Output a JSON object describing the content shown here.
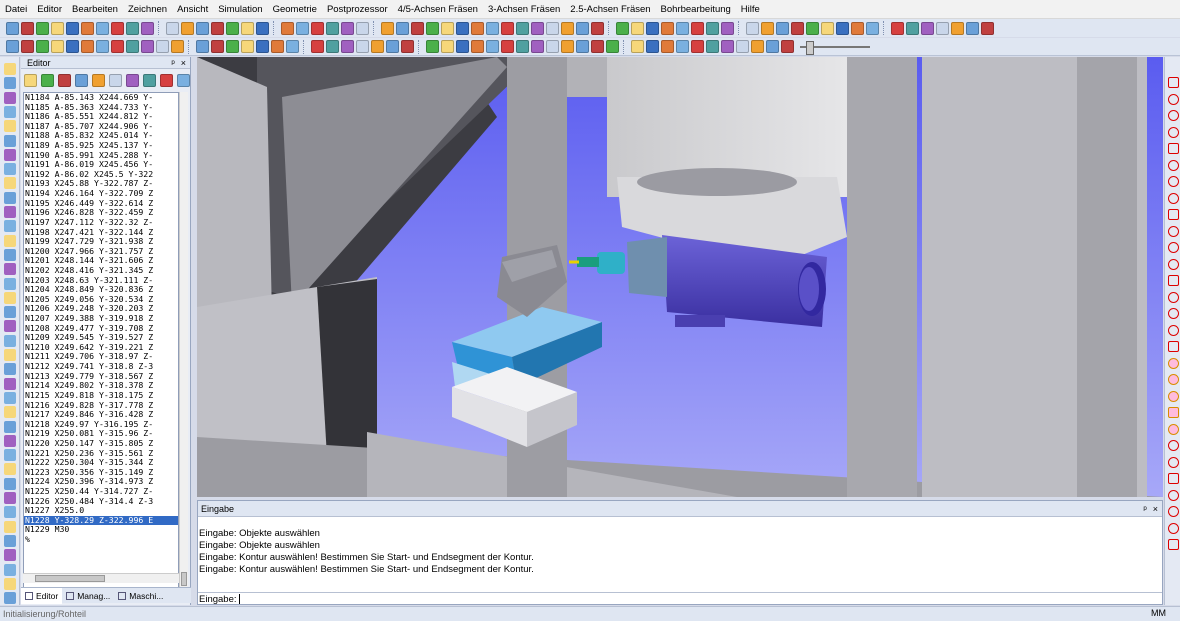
{
  "menu": [
    "Datei",
    "Editor",
    "Bearbeiten",
    "Zeichnen",
    "Ansicht",
    "Simulation",
    "Geometrie",
    "Postprozessor",
    "4/5-Achsen Fräsen",
    "3-Achsen Fräsen",
    "2.5-Achsen Fräsen",
    "Bohrbearbeitung",
    "Hilfe"
  ],
  "editor": {
    "title": "Editor",
    "pin": "ᵖ",
    "close": "×",
    "lines": [
      "N1184 A-85.143 X244.669 Y-",
      "N1185 A-85.363 X244.733 Y-",
      "N1186 A-85.551 X244.812 Y-",
      "N1187 A-85.707 X244.906 Y-",
      "N1188 A-85.832 X245.014 Y-",
      "N1189 A-85.925 X245.137 Y-",
      "N1190 A-85.991 X245.288 Y-",
      "N1191 A-86.019 X245.456 Y-",
      "N1192 A-86.02 X245.5 Y-322",
      "N1193 X245.88 Y-322.787 Z-",
      "N1194 X246.164 Y-322.709 Z",
      "N1195 X246.449 Y-322.614 Z",
      "N1196 X246.828 Y-322.459 Z",
      "N1197 X247.112 Y-322.32 Z-",
      "N1198 X247.421 Y-322.144 Z",
      "N1199 X247.729 Y-321.938 Z",
      "N1200 X247.966 Y-321.757 Z",
      "N1201 X248.144 Y-321.606 Z",
      "N1202 X248.416 Y-321.345 Z",
      "N1203 X248.63 Y-321.111 Z-",
      "N1204 X248.849 Y-320.836 Z",
      "N1205 X249.056 Y-320.534 Z",
      "N1206 X249.248 Y-320.203 Z",
      "N1207 X249.388 Y-319.918 Z",
      "N1208 X249.477 Y-319.708 Z",
      "N1209 X249.545 Y-319.527 Z",
      "N1210 X249.642 Y-319.221 Z",
      "N1211 X249.706 Y-318.97 Z-",
      "N1212 X249.741 Y-318.8 Z-3",
      "N1213 X249.779 Y-318.567 Z",
      "N1214 X249.802 Y-318.378 Z",
      "N1215 X249.818 Y-318.175 Z",
      "N1216 X249.828 Y-317.778 Z",
      "N1217 X249.846 Y-316.428 Z",
      "N1218 X249.97 Y-316.195 Z-",
      "N1219 X250.081 Y-315.96 Z-",
      "N1220 X250.147 Y-315.805 Z",
      "N1221 X250.236 Y-315.561 Z",
      "N1222 X250.304 Y-315.344 Z",
      "N1223 X250.356 Y-315.149 Z",
      "N1224 X250.396 Y-314.973 Z",
      "N1225 X250.44 Y-314.727 Z-",
      "N1226 X250.484 Y-314.4 Z-3",
      "N1227 X255.0",
      "N1228 Y-328.29 Z-322.996 E",
      "N1229 M30",
      "%"
    ],
    "selected_line_index": 44,
    "tabs": [
      "Editor",
      "Manag...",
      "Maschi..."
    ]
  },
  "console": {
    "title": "Eingabe",
    "pin": "ᵖ",
    "close": "×",
    "messages": [
      "Eingabe: Objekte auswählen",
      "Eingabe: Objekte auswählen",
      "Eingabe: Kontur auswählen! Bestimmen Sie Start- und Endsegment der Kontur.",
      "Eingabe: Kontur auswählen! Bestimmen Sie Start- und Endsegment der Kontur."
    ],
    "prompt": "Eingabe:"
  },
  "status": {
    "left": "Initialisierung/Rohteil",
    "unit": "MM"
  },
  "colors": {
    "accent": "#316ac5",
    "viewport_bg": "#6d6ff0",
    "spindle": "#4a3fb0",
    "vise": "#2f93d6"
  }
}
